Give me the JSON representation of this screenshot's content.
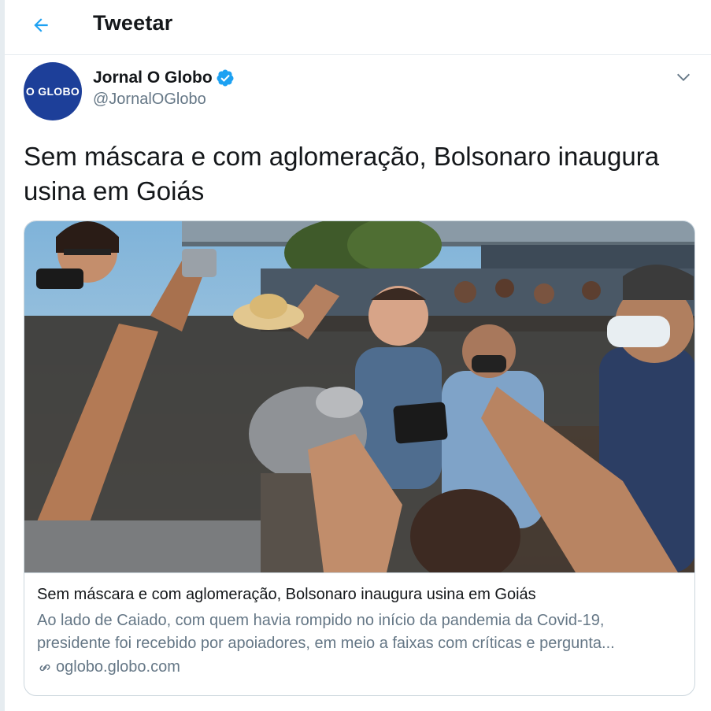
{
  "header": {
    "title": "Tweetar"
  },
  "tweet": {
    "avatar_text": "O GLOBO",
    "author_name": "Jornal O Globo",
    "author_handle": "@JornalOGlobo",
    "text": "Sem máscara e com aglomeração, Bolsonaro inaugura usina em Goiás",
    "card": {
      "title": "Sem máscara e com aglomeração, Bolsonaro inaugura usina em Goiás",
      "description_line1": "Ao lado de Caiado, com quem havia rompido no início da pandemia da Covid-19,",
      "description_line2": "presidente foi recebido por apoiadores, em meio a faixas com críticas e pergunta...",
      "domain": "oglobo.globo.com"
    }
  },
  "colors": {
    "accent": "#1da1f2",
    "avatar_bg": "#1d3f99",
    "secondary_text": "#657786",
    "border": "#ccd6dd"
  },
  "icons": {
    "back": "arrow-left-icon",
    "verified": "verified-badge-icon",
    "caret": "chevron-down-icon",
    "link": "link-icon"
  }
}
